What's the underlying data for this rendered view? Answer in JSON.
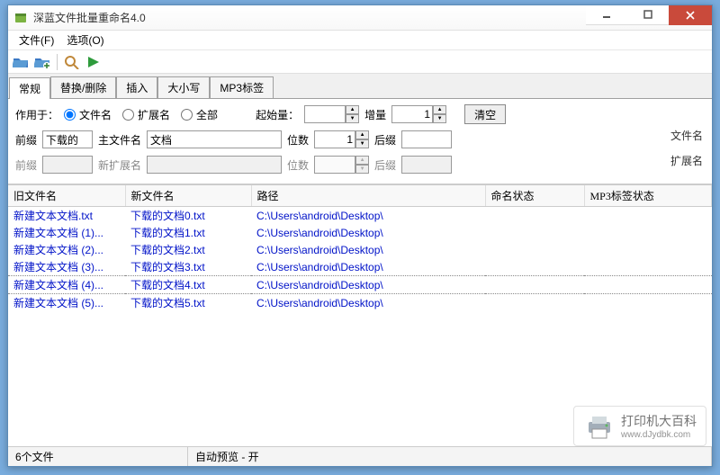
{
  "titlebar": {
    "title": "深蓝文件批量重命名4.0"
  },
  "menubar": {
    "file": "文件(F)",
    "options": "选项(O)"
  },
  "tabs": {
    "items": [
      "常规",
      "替换/删除",
      "插入",
      "大小写",
      "MP3标签"
    ],
    "active": 0
  },
  "panel": {
    "applyTo": "作用于：",
    "radio_filename": "文件名",
    "radio_ext": "扩展名",
    "radio_all": "全部",
    "start_label": "起始量：",
    "start_value": "",
    "increment_label": "增量",
    "increment_value": "1",
    "clear_btn": "清空",
    "filename_section": "文件名",
    "extension_section": "扩展名",
    "prefix_label": "前缀",
    "prefix_value": "下载的",
    "mainname_label": "主文件名",
    "mainname_value": "文档",
    "digits_label": "位数",
    "digits_value": "1",
    "suffix_label": "后缀",
    "suffix_value": "",
    "prefix2_label": "前缀",
    "newext_label": "新扩展名",
    "digits2_label": "位数",
    "suffix2_label": "后缀"
  },
  "table": {
    "headers": [
      "旧文件名",
      "新文件名",
      "路径",
      "命名状态",
      "MP3标签状态"
    ],
    "rows": [
      {
        "old": "新建文本文档.txt",
        "new": "下载的文档0.txt",
        "path": "C:\\Users\\android\\Desktop\\"
      },
      {
        "old": "新建文本文档 (1)...",
        "new": "下载的文档1.txt",
        "path": "C:\\Users\\android\\Desktop\\"
      },
      {
        "old": "新建文本文档 (2)...",
        "new": "下载的文档2.txt",
        "path": "C:\\Users\\android\\Desktop\\"
      },
      {
        "old": "新建文本文档 (3)...",
        "new": "下载的文档3.txt",
        "path": "C:\\Users\\android\\Desktop\\"
      },
      {
        "old": "新建文本文档 (4)...",
        "new": "下载的文档4.txt",
        "path": "C:\\Users\\android\\Desktop\\"
      },
      {
        "old": "新建文本文档 (5)...",
        "new": "下载的文档5.txt",
        "path": "C:\\Users\\android\\Desktop\\"
      }
    ],
    "focused_row": 4
  },
  "status": {
    "file_count": "6个文件",
    "preview": "自动预览 - 开"
  },
  "watermark": {
    "text": "打印机大百科",
    "url": "www.dJydbk.com"
  },
  "colors": {
    "title_bg": "#c94a3b",
    "link": "#0012c8",
    "bg": "#79acdd"
  }
}
